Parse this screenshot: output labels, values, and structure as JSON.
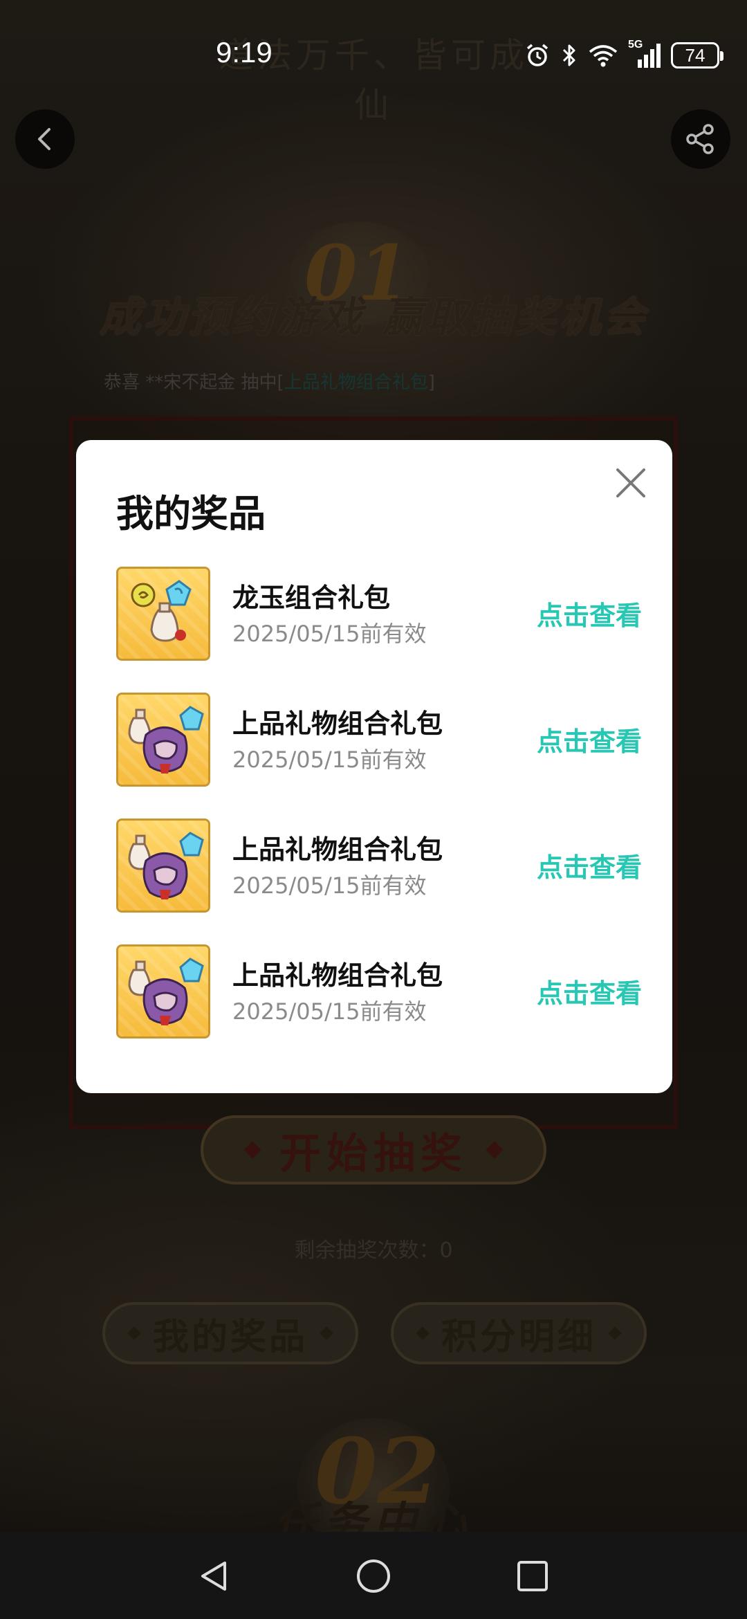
{
  "status_bar": {
    "time": "9:19",
    "network": "5G",
    "battery": "74"
  },
  "background_page": {
    "slogan": "道法万千、皆可成仙",
    "section_number_1": "01",
    "heading": "成功预约游戏 赢取抽奖机会",
    "winner_notice_prefix": "恭喜 **宋不起金 抽中[",
    "winner_notice_prize": "上品礼物组合礼包",
    "winner_notice_suffix": "]",
    "start_draw_label": "开始抽奖",
    "remaining_label": "剩余抽奖次数：",
    "remaining_value": "0",
    "my_prizes_label": "我的奖品",
    "points_detail_label": "积分明细",
    "section_number_2": "02",
    "task_center_label": "任务中心"
  },
  "modal": {
    "title": "我的奖品",
    "close_icon": "close-icon",
    "items": [
      {
        "name": "龙玉组合礼包",
        "validity": "2025/05/15前有效",
        "action": "点击查看",
        "thumb": "dragon-jade"
      },
      {
        "name": "上品礼物组合礼包",
        "validity": "2025/05/15前有效",
        "action": "点击查看",
        "thumb": "premium-gift"
      },
      {
        "name": "上品礼物组合礼包",
        "validity": "2025/05/15前有效",
        "action": "点击查看",
        "thumb": "premium-gift"
      },
      {
        "name": "上品礼物组合礼包",
        "validity": "2025/05/15前有效",
        "action": "点击查看",
        "thumb": "premium-gift"
      }
    ]
  },
  "colors": {
    "accent": "#26c7b3",
    "modal_bg": "#ffffff",
    "thumb_gold": "#f6bb3c"
  }
}
